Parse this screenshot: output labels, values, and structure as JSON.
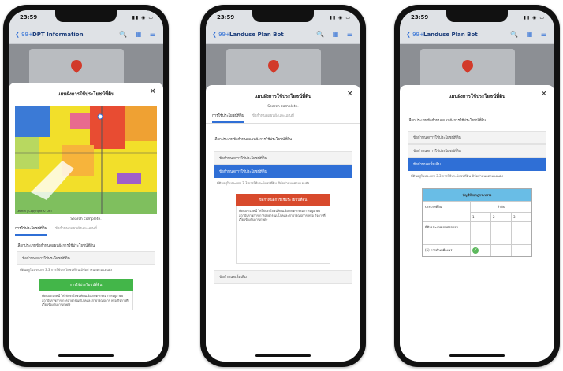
{
  "phones": [
    {
      "time": "23:59",
      "back": "99+",
      "title": "DPT Information",
      "icons": "🔍 ▦ ☰"
    },
    {
      "time": "23:59",
      "back": "99+",
      "title": "Landuse Plan Bot",
      "icons": "🔍 ▦ ☰"
    },
    {
      "time": "23:59",
      "back": "99+",
      "title": "Landuse Plan Bot",
      "icons": "🔍 ▦ ☰"
    }
  ],
  "sheet": {
    "title": "แผนผังการใช้ประโยชน์ที่ดิน",
    "search_status": "Search complete.",
    "tab_active": "การใช้ประโยชน์ที่ดิน",
    "tab_inactive": "ข้อกำหนดแผนผังและแผนที่",
    "question": "เลือกประเภทข้อกำหนดแผนผังการใช้ประโยชน์ที่ดิน",
    "row_type": "ข้อกำหนดการใช้ประโยชน์ที่ดิน",
    "row_selected": "ข้อกำหนดการใช้ประโยชน์ที่ดิน",
    "row_selected3": "ข้อกำหนดเพิ่มเติม",
    "row_bottom": "ข้อกำหนดเพิ่มเติม",
    "note": "ที่ดินอยู่ในประเภท 3.3 การใช้ประโยชน์ที่ดิน มีข้อกำหนดตามแผนผัง",
    "green_btn": "การใช้ประโยชน์ที่ดิน",
    "red_btn": "ข้อกำหนดการใช้ประโยชน์ที่ดิน",
    "para": "ที่ดินประเภทนี้ ให้ใช้ประโยชน์ที่ดินเพื่อเกษตรกรรม การอยู่อาศัย สถาบันราชการ การสาธารณูปโภคและสาธารณูปการ หรือ กิจการที่เกี่ยวข้องกับการเกษตร",
    "map_credit": "Leaflet | Copyright © DPT",
    "table_title": "บัญชีท้ายกฎกระทรวง",
    "table_col": "ลำดับ",
    "table_sub": "ประเภทที่ดิน",
    "table_nums": [
      "1",
      "2",
      "3"
    ],
    "table_row1": "ที่ดินประเภทเกษตรกรรม",
    "table_row2": "(5) การทำเหมืองแร่"
  }
}
